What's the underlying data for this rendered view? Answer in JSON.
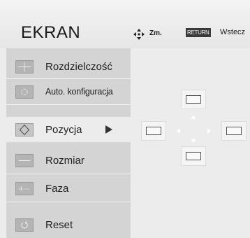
{
  "header": {
    "title": "EKRAN",
    "hint_move_label": "Zm.",
    "hint_return_key": "RETURN",
    "hint_return_label": "Wstecz"
  },
  "menu": {
    "items": [
      {
        "label": "Rozdzielczość",
        "icon": "resolution-icon"
      },
      {
        "label": "Auto. konfiguracja",
        "icon": "auto-config-icon"
      },
      {
        "label": "Pozycja",
        "icon": "position-icon",
        "selected": true
      },
      {
        "label": "Rozmiar",
        "icon": "size-icon"
      },
      {
        "label": "Faza",
        "icon": "phase-icon"
      },
      {
        "label": "Reset",
        "icon": "reset-icon"
      }
    ]
  },
  "position_control": {
    "directions": [
      "up",
      "down",
      "left",
      "right"
    ]
  }
}
